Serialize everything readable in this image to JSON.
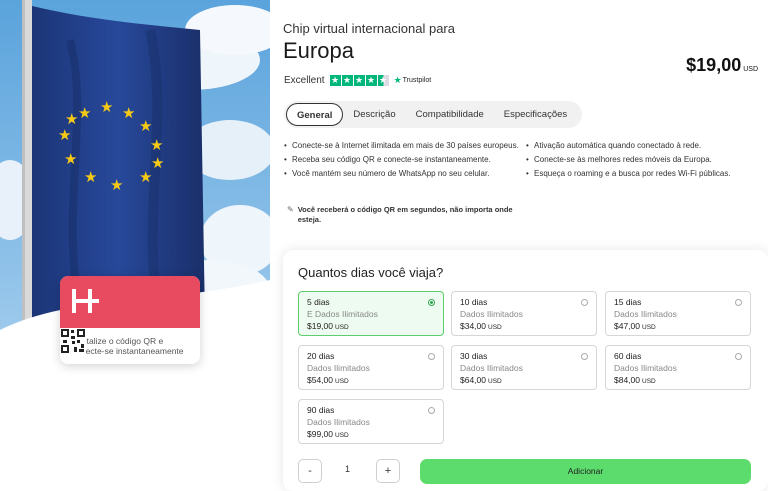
{
  "card": {
    "text": "Digitalize o código QR e conecte-se instantaneamente"
  },
  "product": {
    "subtitle": "Chip virtual internacional para",
    "title": "Europa",
    "price": "$19,00",
    "currency": "USD"
  },
  "rating": {
    "label": "Excellent",
    "stars": 4.5,
    "provider": "Trustpilot"
  },
  "tabs": [
    {
      "label": "General",
      "active": true
    },
    {
      "label": "Descrição",
      "active": false
    },
    {
      "label": "Compatibilidade",
      "active": false
    },
    {
      "label": "Especificações",
      "active": false
    }
  ],
  "features": {
    "left": [
      "Conecte-se à Internet ilimitada em mais de 30 países europeus.",
      "Receba seu código QR e conecte-se instantaneamente.",
      "Você mantém seu número de WhatsApp no seu celular."
    ],
    "right": [
      "Ativação automática quando conectado à rede.",
      "Conecte-se às melhores redes móveis da Europa.",
      "Esqueça o roaming e a busca por redes Wi-Fi públicas."
    ]
  },
  "note": "Você receberá o código QR em segundos, não importa onde esteja.",
  "selector": {
    "title": "Quantos dias você viaja?",
    "options": [
      {
        "days": "5 dias",
        "sub": "E Dados Ilimitados",
        "price": "$19,00",
        "currency": "USD",
        "selected": true
      },
      {
        "days": "10 dias",
        "sub": "Dados Ilimitados",
        "price": "$34,00",
        "currency": "USD",
        "selected": false
      },
      {
        "days": "15 dias",
        "sub": "Dados Ilimitados",
        "price": "$47,00",
        "currency": "USD",
        "selected": false
      },
      {
        "days": "20 dias",
        "sub": "Dados Ilimitados",
        "price": "$54,00",
        "currency": "USD",
        "selected": false
      },
      {
        "days": "30 dias",
        "sub": "Dados Ilimitados",
        "price": "$64,00",
        "currency": "USD",
        "selected": false
      },
      {
        "days": "60 dias",
        "sub": "Dados Ilimitados",
        "price": "$84,00",
        "currency": "USD",
        "selected": false
      },
      {
        "days": "90 dias",
        "sub": "Dados Ilimitados",
        "price": "$99,00",
        "currency": "USD",
        "selected": false
      }
    ],
    "quantity": "1",
    "minus": "-",
    "plus": "+",
    "add_label": "Adicionar"
  },
  "colors": {
    "accent_green": "#5ddc6e",
    "brand_red": "#e84a5f",
    "trustpilot_green": "#00b67a",
    "flag_blue": "#1f3f86",
    "flag_star": "#f6c915"
  }
}
